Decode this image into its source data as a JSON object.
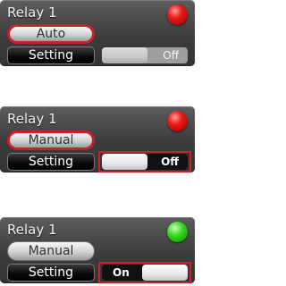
{
  "panels": [
    {
      "title": "Relay 1",
      "led": "red",
      "mode_label": "Auto",
      "setting_label": "Setting",
      "toggle_label": "Off",
      "toggle_state": "off"
    },
    {
      "title": "Relay 1",
      "led": "red",
      "mode_label": "Manual",
      "setting_label": "Setting",
      "toggle_label": "Off",
      "toggle_state": "off"
    },
    {
      "title": "Relay 1",
      "led": "green",
      "mode_label": "Manual",
      "setting_label": "Setting",
      "toggle_label": "On",
      "toggle_state": "on"
    }
  ],
  "colors": {
    "led_off": "#e01010",
    "led_on": "#2ecc1a",
    "highlight": "#cc1f2c",
    "panel": "#444444"
  }
}
